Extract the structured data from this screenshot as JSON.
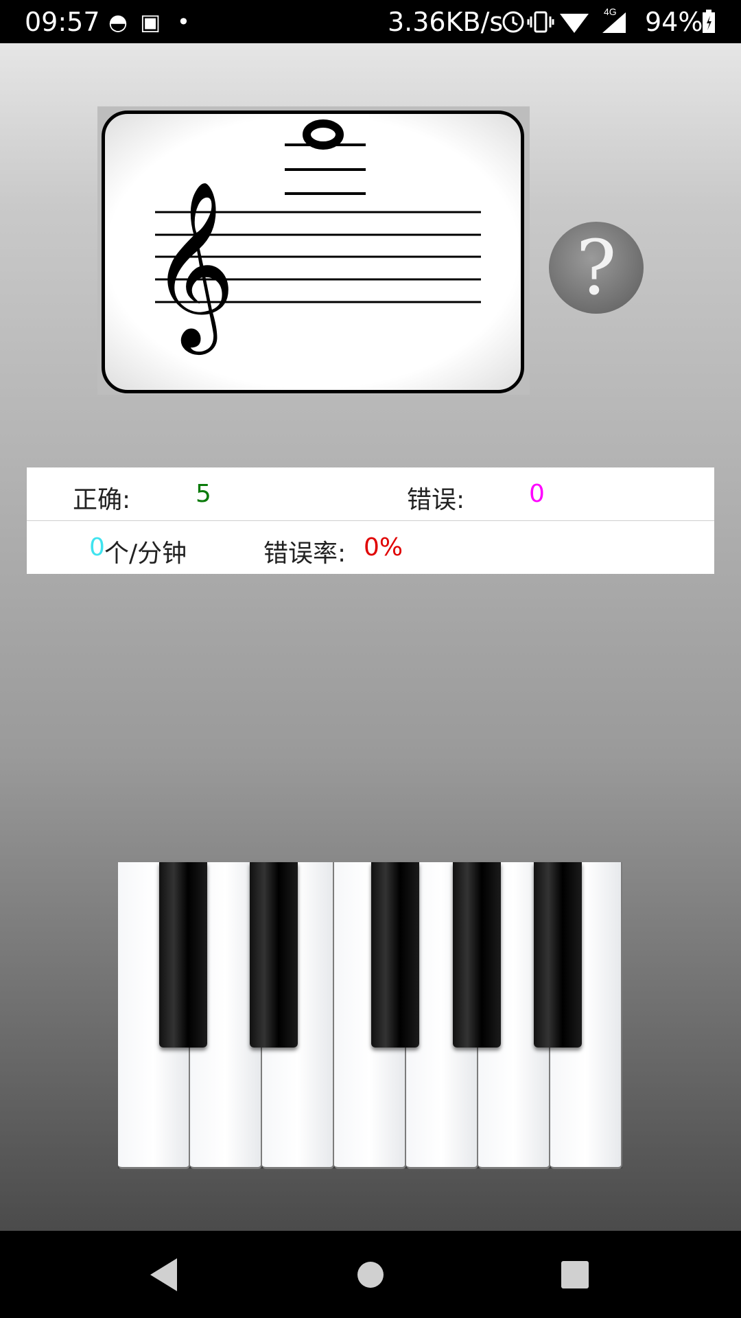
{
  "status_bar": {
    "time": "09:57",
    "net_speed": "3.36KB/s",
    "network_type": "4G",
    "battery": "94%"
  },
  "flashcard": {
    "clef": "treble-clef",
    "note_ledger_lines_above": 3
  },
  "help_button": {
    "label": "?"
  },
  "stats": {
    "correct_label": "正确:",
    "correct_value": "5",
    "wrong_label": "错误:",
    "wrong_value": "0",
    "speed_value": "0",
    "speed_unit": "个/分钟",
    "error_rate_label": "错误率:",
    "error_rate_value": "0%",
    "colors": {
      "correct": "#0a7a0a",
      "wrong": "#ff00ff",
      "speed": "#3fe3ef",
      "error_rate": "#e00000"
    }
  },
  "piano": {
    "white_keys": 7,
    "black_keys": 5
  },
  "nav_bar": {
    "back": "back-icon",
    "home": "home-icon",
    "recents": "recents-icon"
  }
}
